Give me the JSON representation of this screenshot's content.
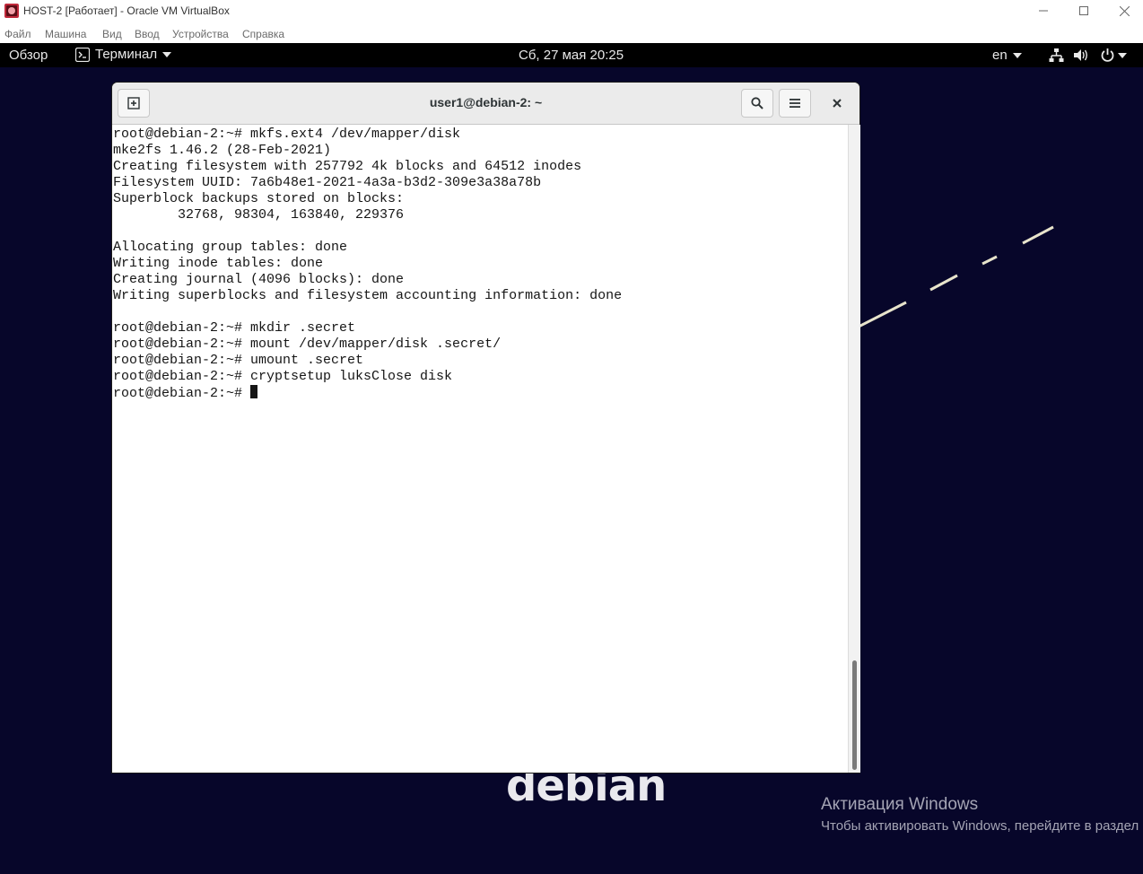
{
  "host": {
    "title": "HOST-2 [Работает] - Oracle VM VirtualBox",
    "menu": [
      "Файл",
      "Машина",
      "Вид",
      "Ввод",
      "Устройства",
      "Справка"
    ]
  },
  "gnome": {
    "activities": "Обзор",
    "app_menu": "Терминал",
    "clock": "Сб, 27 мая  20:25",
    "language": "en"
  },
  "terminal": {
    "title": "user1@debian-2: ~",
    "lines": [
      "root@debian-2:~# mkfs.ext4 /dev/mapper/disk",
      "mke2fs 1.46.2 (28-Feb-2021)",
      "Creating filesystem with 257792 4k blocks and 64512 inodes",
      "Filesystem UUID: 7a6b48e1-2021-4a3a-b3d2-309e3a38a78b",
      "Superblock backups stored on blocks:",
      "        32768, 98304, 163840, 229376",
      "",
      "Allocating group tables: done",
      "Writing inode tables: done",
      "Creating journal (4096 blocks): done",
      "Writing superblocks and filesystem accounting information: done",
      "",
      "root@debian-2:~# mkdir .secret",
      "root@debian-2:~# mount /dev/mapper/disk .secret/",
      "root@debian-2:~# umount .secret",
      "root@debian-2:~# cryptsetup luksClose disk"
    ],
    "prompt": "root@debian-2:~# "
  },
  "desktop": {
    "logo_text": "debian",
    "activation_title": "Активация Windows",
    "activation_subtitle": "Чтобы активировать Windows, перейдите в раздел"
  },
  "colors": {
    "desktop_bg": "#07062a",
    "gnome_bar": "#000000",
    "virtualbox_icon": "#c0283a"
  }
}
